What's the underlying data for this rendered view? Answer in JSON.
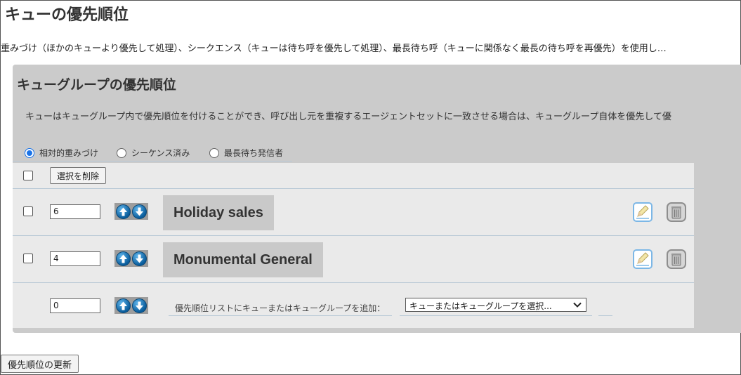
{
  "page": {
    "title": "キューの優先順位",
    "description": "重みづけ（ほかのキューより優先して処理）、シークエンス（キューは待ち呼を優先して処理）、最長待ち呼（キューに関係なく最長の待ち呼を再優先）を使用し…"
  },
  "group": {
    "title": "キューグループの優先順位",
    "description": "キューはキューグループ内で優先順位を付けることができ、呼び出し元を重複するエージェントセットに一致させる場合は、キューグループ自体を優先して優",
    "modes": [
      {
        "label": "相対的重みづけ",
        "checked": true
      },
      {
        "label": "シーケンス済み",
        "checked": false
      },
      {
        "label": "最長待ち発信者",
        "checked": false
      }
    ],
    "delete_selected_label": "選択を削除",
    "rows": [
      {
        "priority": "6",
        "name": "Holiday sales"
      },
      {
        "priority": "4",
        "name": "Monumental General"
      }
    ],
    "add_row": {
      "priority": "0",
      "label": "優先順位リストにキューまたはキューグループを追加：",
      "select_value": "キューまたはキューグループを選択..."
    }
  },
  "update_button_label": "優先順位の更新",
  "icons": {
    "up": "arrow-up-icon",
    "down": "arrow-down-icon",
    "edit": "edit-icon",
    "delete": "trash-icon",
    "select": "chevron-down-icon"
  },
  "colors": {
    "panel_bg": "#cbcbcb",
    "list_bg": "#eaeaea",
    "arrow_blue": "#0a5d9c",
    "radio_checked": "#1a73e8"
  }
}
